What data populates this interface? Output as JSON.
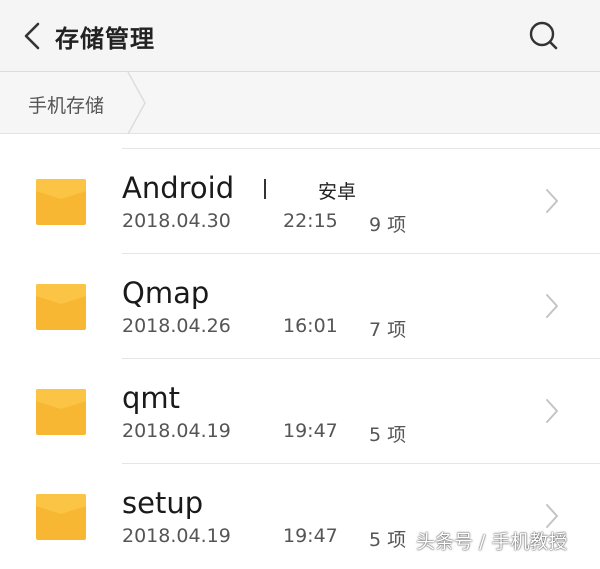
{
  "header": {
    "title": "存储管理",
    "back_icon": "chevron-left-icon",
    "search_icon": "search-icon"
  },
  "breadcrumb": {
    "current": "手机存储"
  },
  "colors": {
    "folder": "#f7b733",
    "folder_flap": "#fcc445",
    "header_bg": "#f5f5f5",
    "chevron": "#c4c4c4"
  },
  "folders": [
    {
      "name": "Android",
      "alias": "安卓",
      "date": "2018.04.30",
      "time": "22:15",
      "count": "9 项"
    },
    {
      "name": "Qmap",
      "date": "2018.04.26",
      "time": "16:01",
      "count": "7 项"
    },
    {
      "name": "qmt",
      "date": "2018.04.19",
      "time": "19:47",
      "count": "5 项"
    },
    {
      "name": "setup",
      "date": "2018.04.19",
      "time": "19:47",
      "count": "5 项"
    }
  ],
  "watermark": "头条号 / 手机教授"
}
